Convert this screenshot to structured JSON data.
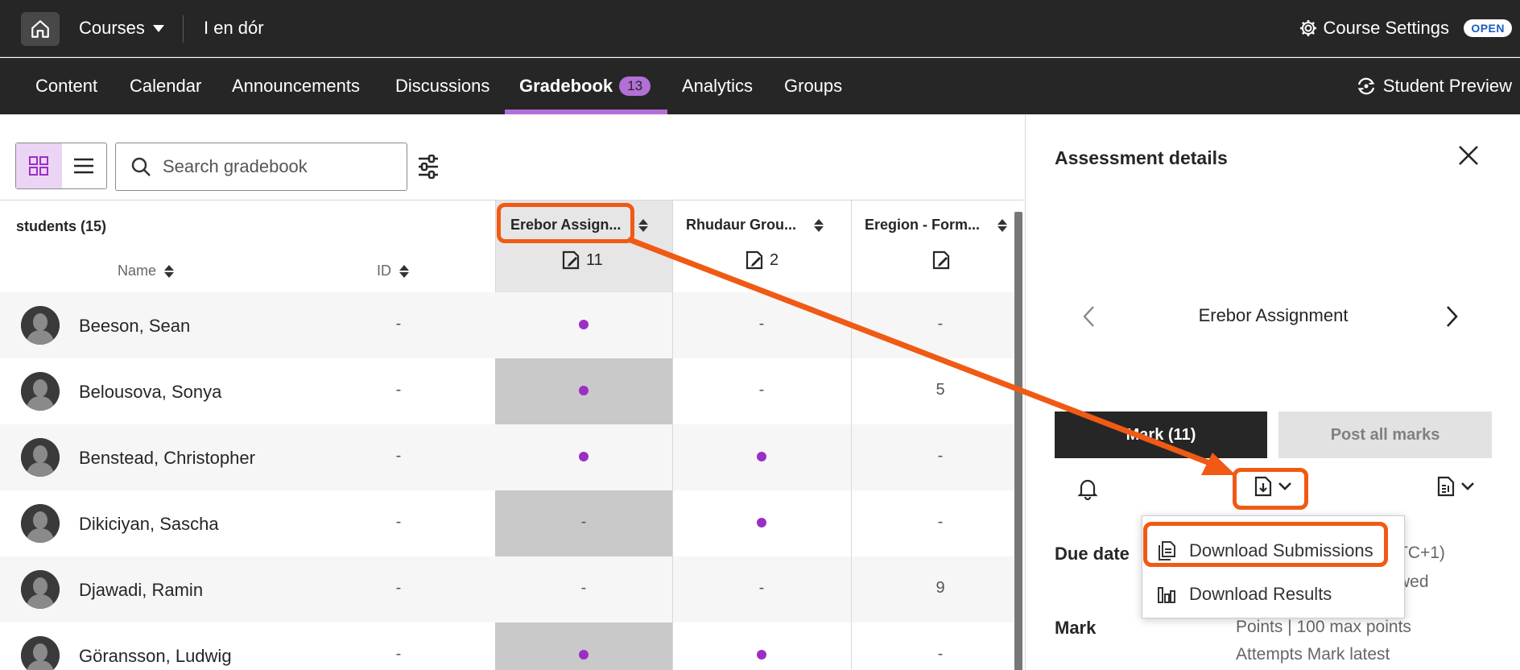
{
  "topbar": {
    "courses_label": "Courses",
    "course_name": "I en dór",
    "settings_label": "Course Settings",
    "open_badge": "OPEN"
  },
  "nav": {
    "tabs": [
      "Content",
      "Calendar",
      "Announcements",
      "Discussions",
      "Gradebook",
      "Analytics",
      "Groups"
    ],
    "active_tab": "Gradebook",
    "gradebook_badge": "13",
    "student_preview": "Student Preview"
  },
  "toolbar": {
    "search_placeholder": "Search gradebook"
  },
  "grid": {
    "students_header": "students (15)",
    "name_header": "Name",
    "id_header": "ID",
    "columns": [
      {
        "title": "Erebor Assign...",
        "count": "11"
      },
      {
        "title": "Rhudaur Grou...",
        "count": "2"
      },
      {
        "title": "Eregion - Form...",
        "count": ""
      }
    ],
    "rows": [
      {
        "name": "Beeson, Sean",
        "id": "-",
        "c1": "dot",
        "c2": "-",
        "c3": "-"
      },
      {
        "name": "Belousova, Sonya",
        "id": "-",
        "c1": "dot",
        "c2": "-",
        "c3": "5"
      },
      {
        "name": "Benstead, Christopher",
        "id": "-",
        "c1": "dot",
        "c2": "dot",
        "c3": "-"
      },
      {
        "name": "Dikiciyan, Sascha",
        "id": "-",
        "c1": "-",
        "c2": "dot",
        "c3": "-"
      },
      {
        "name": "Djawadi, Ramin",
        "id": "-",
        "c1": "-",
        "c2": "-",
        "c3": "9"
      },
      {
        "name": "Göransson, Ludwig",
        "id": "-",
        "c1": "dot",
        "c2": "dot",
        "c3": "-"
      }
    ]
  },
  "panel": {
    "title": "Assessment details",
    "assignment": "Erebor Assignment",
    "mark_button": "Mark (11)",
    "post_button": "Post all marks",
    "due_label": "Due date",
    "due_value_1": "TC+1)",
    "due_value_2": "wed",
    "mark_label": "Mark",
    "mark_value_1": "Points | 100 max points",
    "mark_value_2": "Attempts Mark latest"
  },
  "dropdown": {
    "items": [
      "Download Submissions",
      "Download Results"
    ]
  },
  "colors": {
    "accent_purple": "#b26fd6",
    "dot_purple": "#9b2fc4",
    "highlight_orange": "#f05a14",
    "dark_bar": "#262626"
  }
}
